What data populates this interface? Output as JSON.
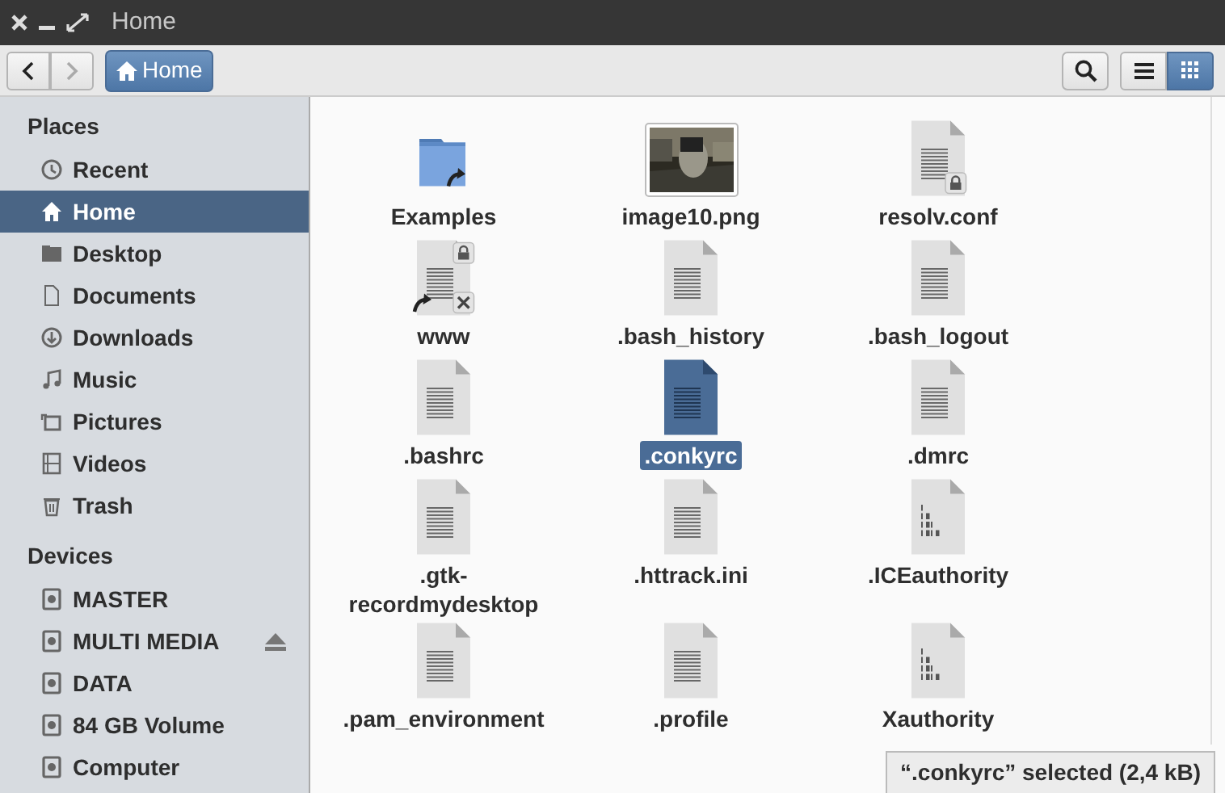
{
  "window": {
    "title": "Home"
  },
  "toolbar": {
    "back_disabled": false,
    "forward_disabled": true,
    "location": "Home",
    "view_modes": [
      {
        "kind": "list",
        "selected": false
      },
      {
        "kind": "grid",
        "selected": true
      }
    ]
  },
  "sidebar": {
    "sections": [
      {
        "title": "Places",
        "items": [
          {
            "label": "Recent",
            "kind": "recent",
            "selected": false
          },
          {
            "label": "Home",
            "kind": "home",
            "selected": true
          },
          {
            "label": "Desktop",
            "kind": "desktop",
            "selected": false
          },
          {
            "label": "Documents",
            "kind": "documents",
            "selected": false
          },
          {
            "label": "Downloads",
            "kind": "downloads",
            "selected": false
          },
          {
            "label": "Music",
            "kind": "music",
            "selected": false
          },
          {
            "label": "Pictures",
            "kind": "pictures",
            "selected": false
          },
          {
            "label": "Videos",
            "kind": "videos",
            "selected": false
          },
          {
            "label": "Trash",
            "kind": "trash",
            "selected": false
          }
        ]
      },
      {
        "title": "Devices",
        "items": [
          {
            "label": "MASTER",
            "kind": "drive",
            "selected": false,
            "ejectable": false
          },
          {
            "label": "MULTI MEDIA",
            "kind": "drive",
            "selected": false,
            "ejectable": true
          },
          {
            "label": "DATA",
            "kind": "drive",
            "selected": false,
            "ejectable": false
          },
          {
            "label": "84 GB Volume",
            "kind": "drive",
            "selected": false,
            "ejectable": false
          },
          {
            "label": "Computer",
            "kind": "drive",
            "selected": false,
            "ejectable": false
          }
        ]
      }
    ]
  },
  "files": [
    {
      "name": "Examples",
      "kind": "folder-link",
      "selected": false
    },
    {
      "name": "image10.png",
      "selected": false
    },
    {
      "name": "resolv.conf",
      "kind": "text-locked",
      "selected": false
    },
    {
      "name": "www",
      "kind": "broken-link",
      "selected": false
    },
    {
      "name": ".bash_history",
      "kind": "text",
      "selected": false
    },
    {
      "name": ".bash_logout",
      "kind": "text",
      "selected": false
    },
    {
      "name": ".bashrc",
      "kind": "text",
      "selected": false
    },
    {
      "name": ".conkyrc",
      "kind": "text",
      "selected": true
    },
    {
      "name": ".dmrc",
      "kind": "text",
      "selected": false
    },
    {
      "name": ".gtk-recordmydesktop",
      "kind": "text",
      "selected": false
    },
    {
      "name": ".httrack.ini",
      "kind": "text",
      "selected": false
    },
    {
      "name": ".ICEauthority",
      "kind": "binary",
      "selected": false
    },
    {
      "name": ".pam_environment",
      "kind": "text",
      "selected": false
    },
    {
      "name": ".profile",
      "kind": "text",
      "selected": false
    },
    {
      "name": "Xauthority",
      "kind": "binary",
      "selected": false
    }
  ],
  "status": "“.conkyrc” selected (2,4 kB)"
}
